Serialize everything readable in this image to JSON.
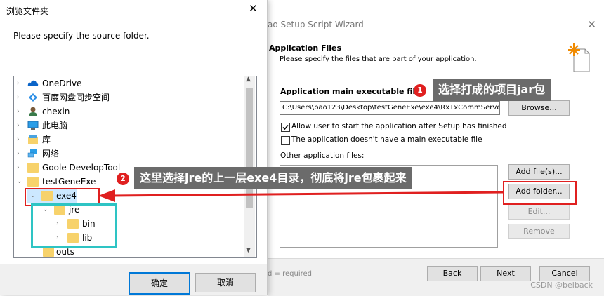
{
  "wizard": {
    "title": "ao Setup Script Wizard",
    "header_title": "Application Files",
    "header_subtitle": "Please specify the files that are part of your application.",
    "main_exe_label": "Application main executable file:",
    "main_exe_value": "C:\\Users\\bao123\\Desktop\\testGeneExe\\exe4\\RxTxCommServe",
    "browse_label": "Browse...",
    "allow_start_label": "Allow user to start the application after Setup has finished",
    "no_main_exe_label": "The application doesn't have a main executable file",
    "other_files_label": "Other application files:",
    "add_files_label": "Add file(s)...",
    "add_folder_label": "Add folder...",
    "edit_label": "Edit...",
    "remove_label": "Remove",
    "footer_note": "d = required",
    "back_label": "Back",
    "next_label": "Next",
    "cancel_label": "Cancel"
  },
  "dialog": {
    "title": "浏览文件夹",
    "prompt": "Please specify the source folder.",
    "tree": [
      {
        "label": "OneDrive",
        "icon": "cloud-icon"
      },
      {
        "label": "百度网盘同步空间",
        "icon": "baidu-icon"
      },
      {
        "label": "chexin",
        "icon": "user-icon"
      },
      {
        "label": "此电脑",
        "icon": "computer-icon"
      },
      {
        "label": "库",
        "icon": "library-icon"
      },
      {
        "label": "网络",
        "icon": "network-icon"
      },
      {
        "label": "Goole DevelopTool",
        "icon": "folder-icon"
      },
      {
        "label": "testGeneExe",
        "icon": "folder-icon"
      },
      {
        "label": "exe4",
        "icon": "folder-icon"
      },
      {
        "label": "jre",
        "icon": "folder-icon"
      },
      {
        "label": "bin",
        "icon": "folder-icon"
      },
      {
        "label": "lib",
        "icon": "folder-icon"
      },
      {
        "label": "outs",
        "icon": "folder-icon"
      }
    ],
    "ok_label": "确定",
    "cancel_label": "取消"
  },
  "annotations": {
    "badge1": "1",
    "note1": "选择打成的项目jar包",
    "badge2": "2",
    "note2": "这里选择jre的上一层exe4目录，彻底将jre包裹起来"
  },
  "watermark": "CSDN @beiback",
  "colors": {
    "accent": "#0078d7",
    "annotation_red": "#e02020",
    "highlight_cyan": "#2ec4c4",
    "folder": "#f7d26b"
  }
}
